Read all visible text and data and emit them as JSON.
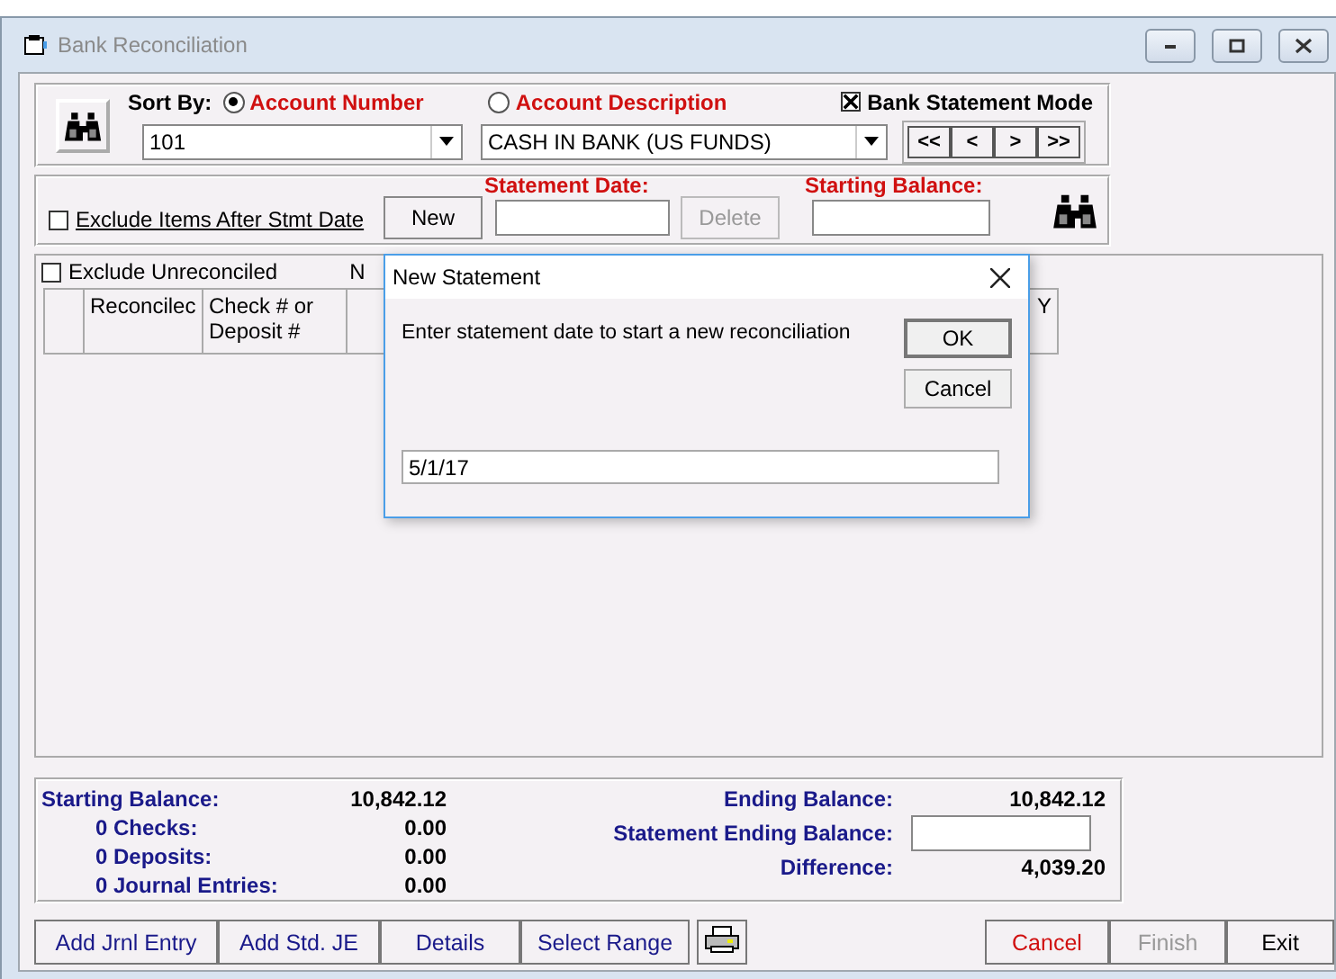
{
  "window": {
    "title": "Bank Reconciliation"
  },
  "sort": {
    "label": "Sort By:",
    "options": [
      {
        "label": "Account Number",
        "selected": true
      },
      {
        "label": "Account Description",
        "selected": false
      }
    ]
  },
  "account_number": {
    "value": "101"
  },
  "account_description": {
    "value": "CASH IN BANK (US FUNDS)"
  },
  "bank_statement_mode": {
    "label": "Bank Statement Mode",
    "checked": true
  },
  "nav_buttons": [
    "<<",
    "<",
    ">",
    ">>"
  ],
  "exclude_after": {
    "label": "Exclude Items After Stmt Date",
    "checked": false
  },
  "new_button": {
    "label": "New"
  },
  "statement_date": {
    "label": "Statement Date:"
  },
  "delete_button": {
    "label": "Delete",
    "disabled": true
  },
  "starting_balance_field": {
    "label": "Starting Balance:"
  },
  "grid": {
    "exclude_unreconciled": {
      "label": "Exclude Unreconciled",
      "checked": false
    },
    "column_label_cut": "N",
    "columns": [
      "Reconcilec",
      "Check # or Deposit #",
      "Y"
    ]
  },
  "dialog": {
    "title": "New Statement",
    "message": "Enter statement date to start a new reconciliation",
    "value": "5/1/17",
    "buttons": [
      {
        "label": "OK",
        "default": true
      },
      {
        "label": "Cancel",
        "default": false
      }
    ]
  },
  "summary": {
    "left": [
      {
        "kind": "total",
        "label": "Starting Balance:",
        "value": "10,842.12"
      },
      {
        "kind": "count",
        "label": "0 Checks:",
        "value": "0.00"
      },
      {
        "kind": "count",
        "label": "0 Deposits:",
        "value": "0.00"
      },
      {
        "kind": "count",
        "label": "0 Journal Entries:",
        "value": "0.00"
      }
    ],
    "ending_balance": {
      "label": "Ending Balance:",
      "value": "10,842.12"
    },
    "statement_ending_balance": {
      "label": "Statement Ending Balance:"
    },
    "difference": {
      "label": "Difference:",
      "value": "4,039.20"
    }
  },
  "footer": {
    "left": [
      {
        "label": "Add Jrnl Entry"
      },
      {
        "label": "Add Std. JE"
      },
      {
        "label": "Details"
      },
      {
        "label": "Select Range"
      }
    ],
    "right": [
      {
        "label": "Cancel",
        "kind": "danger",
        "disabled": false
      },
      {
        "label": "Finish",
        "disabled": true
      },
      {
        "label": "Exit",
        "kind": "normal",
        "disabled": false
      }
    ]
  }
}
